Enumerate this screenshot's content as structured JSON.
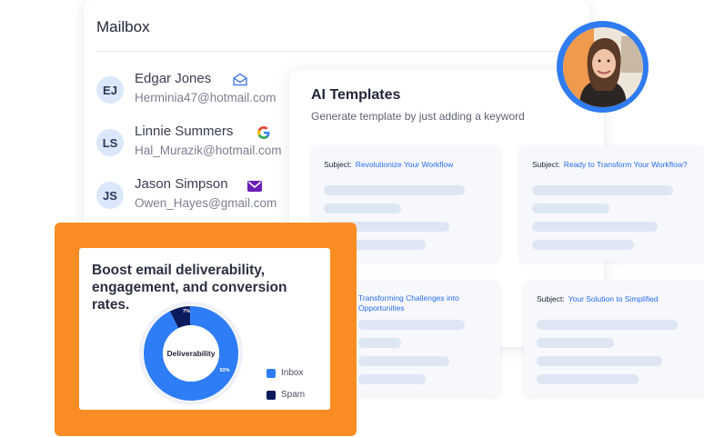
{
  "mailbox": {
    "title": "Mailbox",
    "contacts": [
      {
        "initials": "EJ",
        "name": "Edgar Jones",
        "email": "Herminia47@hotmail.com",
        "icon": "open-envelope-icon"
      },
      {
        "initials": "LS",
        "name": "Linnie Summers",
        "email": "Hal_Murazik@hotmail.com",
        "icon": "google-icon"
      },
      {
        "initials": "JS",
        "name": "Jason Simpson",
        "email": "Owen_Hayes@gmail.com",
        "icon": "yahoo-mail-icon"
      }
    ]
  },
  "ai_templates": {
    "title": "AI Templates",
    "subtitle": "Generate template by just adding a keyword",
    "subject_label": "Subject:",
    "templates": [
      {
        "subject": "Revolutionize Your Workflow"
      },
      {
        "subject": "Ready to Transform Your Workflow?"
      },
      {
        "subject": "Transforming Challenges into Opportunities"
      },
      {
        "subject": "Your Solution to Simplified"
      }
    ]
  },
  "promo": {
    "heading": "Boost email deliverability, engagement, and conversion rates.",
    "donut_center": "Deliverability",
    "inbox_pct_label": "93%",
    "spam_pct_label": "7%",
    "legend": [
      {
        "label": "Inbox",
        "color": "#2e7cf6"
      },
      {
        "label": "Spam",
        "color": "#0b1a5c"
      }
    ]
  },
  "chart_data": {
    "type": "pie",
    "title": "",
    "categories": [
      "Inbox",
      "Spam"
    ],
    "values": [
      93,
      7
    ],
    "colors": [
      "#2e7cf6",
      "#0b1a5c"
    ]
  },
  "colors": {
    "accent": "#2a6cf0",
    "orange": "#f98d24",
    "avatar_bg": "#dbe8fb"
  }
}
